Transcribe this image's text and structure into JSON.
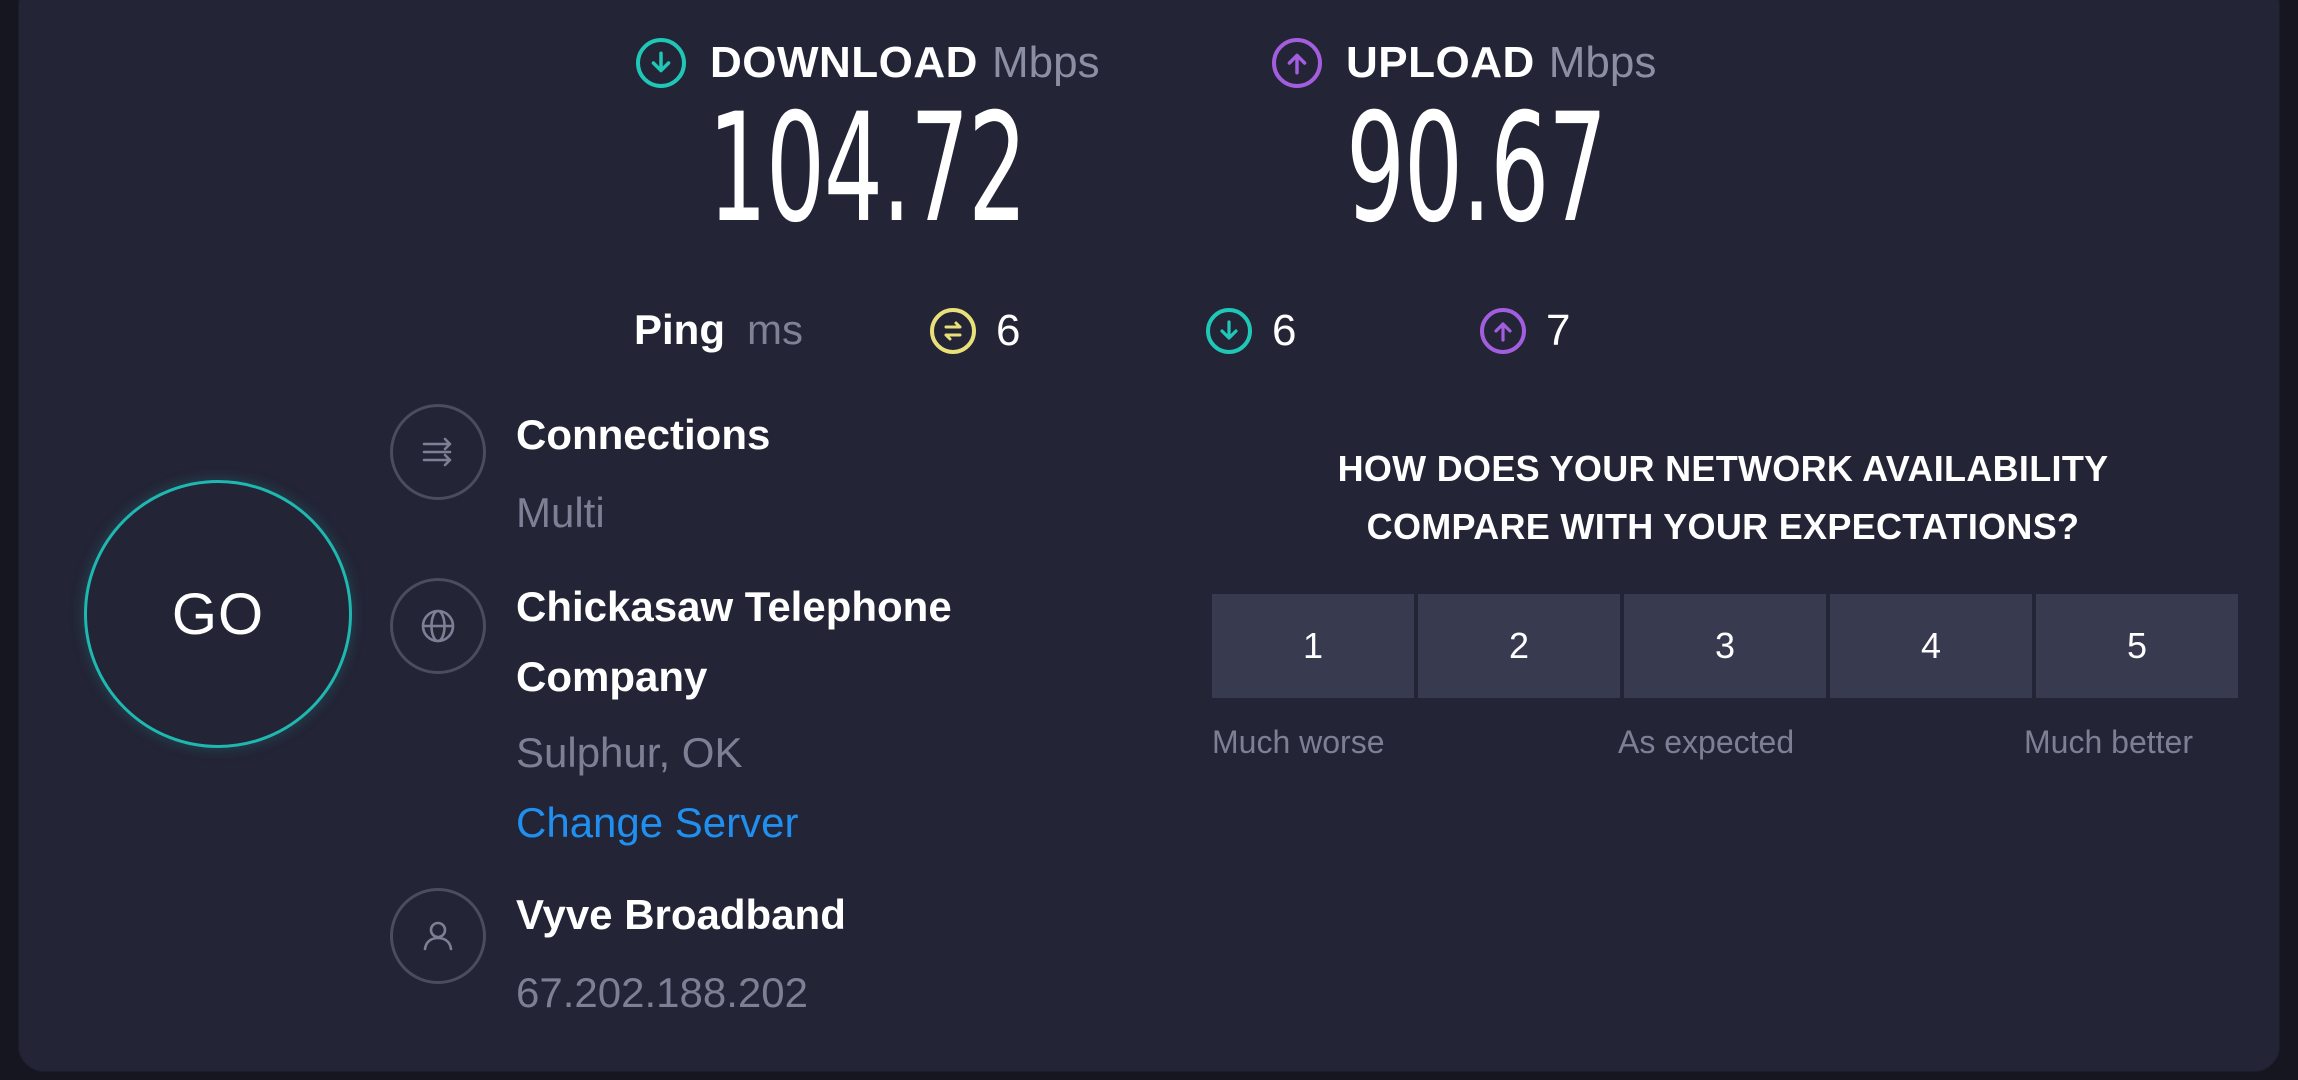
{
  "download": {
    "label": "DOWNLOAD",
    "unit": "Mbps",
    "value": "104.72",
    "icon": "download-arrow-icon",
    "color": "#1fc7b6"
  },
  "upload": {
    "label": "UPLOAD",
    "unit": "Mbps",
    "value": "90.67",
    "icon": "upload-arrow-icon",
    "color": "#a35ee0"
  },
  "ping": {
    "label": "Ping",
    "unit": "ms",
    "items": [
      {
        "icon": "idle-ping-icon",
        "value": "6",
        "color": "#e9e07a"
      },
      {
        "icon": "download-ping-icon",
        "value": "6",
        "color": "#1fc7b6"
      },
      {
        "icon": "upload-ping-icon",
        "value": "7",
        "color": "#a35ee0"
      }
    ]
  },
  "go_button": {
    "label": "GO",
    "color": "#1fb8b0"
  },
  "connections": {
    "title": "Connections",
    "value": "Multi",
    "icon": "connections-icon"
  },
  "server": {
    "name_line1": "Chickasaw Telephone",
    "name_line2": "Company",
    "location": "Sulphur, OK",
    "change_label": "Change Server",
    "icon": "globe-icon",
    "link_color": "#1f8ff0"
  },
  "provider": {
    "name": "Vyve Broadband",
    "ip": "67.202.188.202",
    "icon": "user-icon"
  },
  "survey": {
    "question_line1": "HOW DOES YOUR NETWORK AVAILABILITY",
    "question_line2": "COMPARE WITH YOUR EXPECTATIONS?",
    "ratings": [
      "1",
      "2",
      "3",
      "4",
      "5"
    ],
    "scale_low": "Much worse",
    "scale_mid": "As expected",
    "scale_high": "Much better"
  }
}
